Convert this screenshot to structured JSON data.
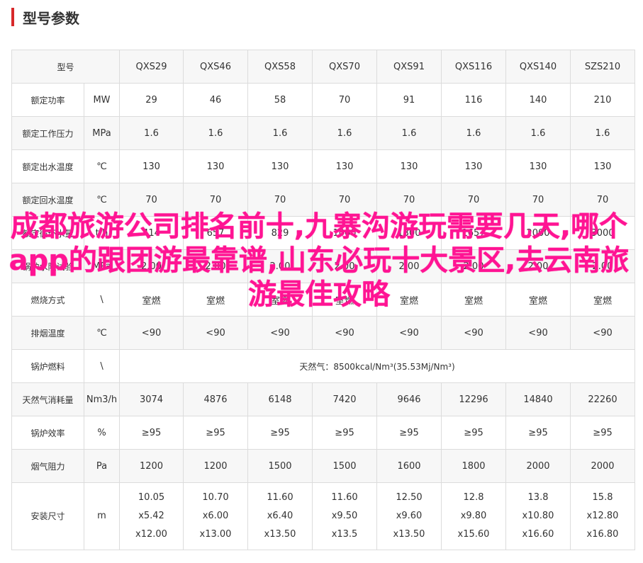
{
  "section_title": "型号参数",
  "overlay_text": "成都旅游公司排名前十,九寨沟游玩需要几天,哪个app的跟团游最靠谱,山东必玩十大景区,去云南旅游最佳攻略",
  "header": {
    "label": "型号",
    "models": [
      "QXS29",
      "QXS46",
      "QXS58",
      "QXS70",
      "QXS91",
      "QXS116",
      "QXS140",
      "SZS210"
    ]
  },
  "rows": [
    {
      "label": "额定功率",
      "unit": "MW",
      "values": [
        "29",
        "46",
        "58",
        "70",
        "91",
        "116",
        "140",
        "210"
      ]
    },
    {
      "label": "额定工作压力",
      "unit": "MPa",
      "values": [
        "1.6",
        "1.6",
        "1.6",
        "1.6",
        "1.6",
        "1.6",
        "1.6",
        "1.6"
      ]
    },
    {
      "label": "额定出水温度",
      "unit": "℃",
      "values": [
        "130",
        "130",
        "130",
        "130",
        "130",
        "130",
        "130",
        "130"
      ]
    },
    {
      "label": "额定回水温度",
      "unit": "℃",
      "values": [
        "70",
        "70",
        "70",
        "70",
        "70",
        "70",
        "70",
        "70"
      ]
    },
    {
      "label": "额定循环水量",
      "unit": "t/h",
      "values": [
        "414",
        "657",
        "829",
        "1000",
        "1300",
        "1657",
        "2000",
        "3000"
      ]
    },
    {
      "label": "锅炉水阻试验",
      "unit": "MPa",
      "values": [
        "2.00",
        "2.00",
        "2.00",
        "2.00",
        "2.00",
        "2.00",
        "2.00",
        "2.00"
      ]
    },
    {
      "label": "燃烧方式",
      "unit": "\\",
      "values": [
        "室燃",
        "室燃",
        "室燃",
        "室燃",
        "室燃",
        "室燃",
        "室燃",
        "室燃"
      ]
    },
    {
      "label": "排烟温度",
      "unit": "℃",
      "values": [
        "<90",
        "<90",
        "<90",
        "<90",
        "<90",
        "<90",
        "<90",
        "<90"
      ]
    }
  ],
  "fuel_row": {
    "label": "锅炉燃料",
    "unit": "\\",
    "value": "天然气：8500kcal/Nm³(35.53Mj/Nm³)"
  },
  "rows2": [
    {
      "label": "天然气消耗量",
      "unit": "Nm3/h",
      "values": [
        "3074",
        "4876",
        "6148",
        "7420",
        "9646",
        "12296",
        "14840",
        "22260"
      ]
    },
    {
      "label": "锅炉效率",
      "unit": "%",
      "values": [
        "≥95",
        "≥95",
        "≥95",
        "≥95",
        "≥95",
        "≥95",
        "≥95",
        "≥95"
      ]
    },
    {
      "label": "烟气阻力",
      "unit": "Pa",
      "values": [
        "1200",
        "1200",
        "1500",
        "1500",
        "1600",
        "1800",
        "2000",
        "2000"
      ]
    }
  ],
  "size_row": {
    "label": "安装尺寸",
    "unit": "m",
    "values": [
      [
        "10.05",
        "x5.42",
        "x12.00"
      ],
      [
        "10.70",
        "x6.00",
        "x13.00"
      ],
      [
        "11.60",
        "x6.40",
        "x13.50"
      ],
      [
        "11.60",
        "x9.50",
        "x13.5"
      ],
      [
        "12.50",
        "x9.60",
        "x13.50"
      ],
      [
        "12.8",
        "x9.80",
        "x15.60"
      ],
      [
        "13.8",
        "x10.80",
        "x16.60"
      ],
      [
        "15.8",
        "x12.80",
        "x16.80"
      ]
    ]
  },
  "colors": {
    "accent": "#d7282a",
    "overlay": "#ff1493",
    "border": "#dcdcdc"
  }
}
